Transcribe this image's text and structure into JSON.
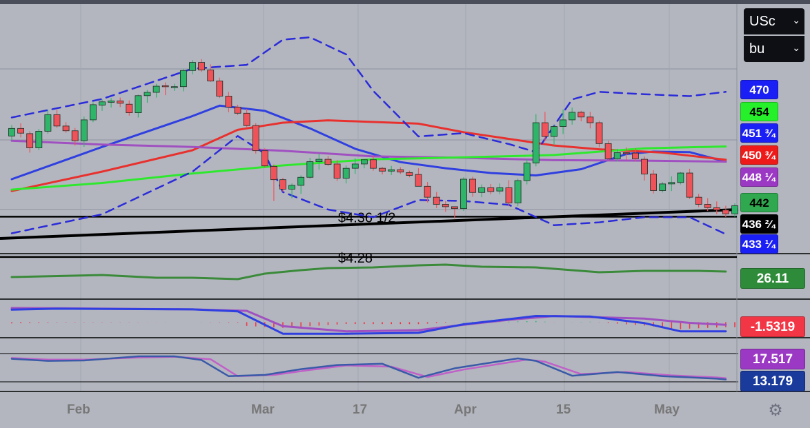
{
  "toolbar": {
    "currency": "USc",
    "unit": "bu",
    "chevron": "⌄"
  },
  "price_labels": [
    {
      "text": "470",
      "bg": "#1a1ff5"
    },
    {
      "text": "454",
      "bg": "#26f02a",
      "fg": "#000000"
    },
    {
      "text": "451 ³⁄₄",
      "bg": "#1a1ff5"
    },
    {
      "text": "450 ³⁄₄",
      "bg": "#ee1a1a"
    },
    {
      "text": "448 ¹⁄₄",
      "bg": "#9b38c4"
    },
    {
      "text": "442",
      "bg": "#2fa84f",
      "fg": "#000000"
    },
    {
      "text": "436 ²⁄₄",
      "bg": "#000000"
    },
    {
      "text": "433 ¹⁄₄",
      "bg": "#1a1ff5"
    }
  ],
  "oscillator_labels": [
    {
      "text": "26.11",
      "bg": "#2e8b3a"
    },
    {
      "text": "-1.5319",
      "bg": "#f23645"
    },
    {
      "text": "17.517",
      "bg": "#9b38c4"
    },
    {
      "text": "13.179",
      "bg": "#1a3a9c"
    }
  ],
  "annotations": [
    "$4.36 1/2",
    "$4.28"
  ],
  "x_axis": [
    "Feb",
    "Mar",
    "17",
    "Apr",
    "15",
    "May"
  ],
  "icons": {
    "settings": "gear-icon"
  },
  "colors": {
    "up": "#2fb56a",
    "down": "#f0525a",
    "boll": "#2b2bd9",
    "sma_green": "#2ee82e",
    "sma_purple": "#a050c0",
    "sma_red": "#e8312e",
    "sma_blue": "#2f3fe0"
  },
  "chart_data": {
    "type": "candlestick",
    "price_range": [
      429,
      481
    ],
    "levels": [
      {
        "name": "$4.36 1/2",
        "value": 436.5
      },
      {
        "name": "$4.28",
        "value": 428
      }
    ],
    "candles": [
      [
        453.5,
        455.8,
        452.6,
        455.1
      ],
      [
        455.1,
        456.2,
        453.2,
        454.1
      ],
      [
        454,
        454.5,
        450,
        451
      ],
      [
        451,
        455,
        450.5,
        454.5
      ],
      [
        454.5,
        459,
        454,
        458
      ],
      [
        458,
        459,
        455.2,
        455.6
      ],
      [
        455.6,
        456.4,
        454.2,
        454.6
      ],
      [
        454.6,
        455.2,
        451.5,
        452.5
      ],
      [
        452.5,
        457.6,
        451.2,
        456.9
      ],
      [
        456.9,
        460.6,
        456.4,
        460.1
      ],
      [
        460,
        461.2,
        458.8,
        460.7
      ],
      [
        460.6,
        461.5,
        459.5,
        460.9
      ],
      [
        460.9,
        461.6,
        459.6,
        460.4
      ],
      [
        460.2,
        461,
        457.8,
        458.4
      ],
      [
        458.4,
        462.2,
        457.4,
        462
      ],
      [
        462,
        463.2,
        460.5,
        462.7
      ],
      [
        462.7,
        464.5,
        461.6,
        464
      ],
      [
        464.1,
        464.8,
        462.1,
        463.9
      ],
      [
        463.9,
        464.5,
        463,
        463.9
      ],
      [
        463.9,
        467.7,
        462.9,
        467.3
      ],
      [
        467.3,
        469.5,
        466.5,
        469
      ],
      [
        469,
        469.7,
        467,
        467.4
      ],
      [
        467.4,
        468.6,
        464.9,
        465.1
      ],
      [
        465.1,
        465.8,
        461.5,
        461.9
      ],
      [
        461.9,
        462.8,
        458.5,
        459.6
      ],
      [
        459.6,
        460.1,
        457.9,
        458.3
      ],
      [
        458.3,
        459.2,
        455.4,
        455.7
      ],
      [
        455.7,
        456.2,
        449.8,
        450.4
      ],
      [
        450.4,
        450.9,
        446.9,
        447.2
      ],
      [
        447.1,
        447.5,
        439.8,
        444.3
      ],
      [
        444.3,
        444.7,
        441.8,
        442.3
      ],
      [
        442.3,
        443.5,
        440.4,
        443.1
      ],
      [
        443.1,
        445.2,
        441.3,
        444.8
      ],
      [
        444.8,
        448.9,
        444.5,
        448.1
      ],
      [
        448.1,
        449.7,
        446.4,
        448.6
      ],
      [
        448.6,
        449.3,
        447.2,
        447.5
      ],
      [
        447.6,
        448.4,
        444,
        444.6
      ],
      [
        444.6,
        447.3,
        443.5,
        446.7
      ],
      [
        446.7,
        448.8,
        445.5,
        447.6
      ],
      [
        447.6,
        448.6,
        446.7,
        448.5
      ],
      [
        448.5,
        449.3,
        446.2,
        446.7
      ],
      [
        446.7,
        447,
        445.4,
        446.1
      ],
      [
        446.1,
        447.2,
        445.3,
        446.4
      ],
      [
        446.4,
        446.9,
        445.5,
        445.9
      ],
      [
        445.8,
        446.2,
        444.8,
        445.2
      ],
      [
        445.4,
        446.7,
        442.9,
        442.9
      ],
      [
        442.9,
        443.8,
        439.5,
        440.6
      ],
      [
        440.6,
        441.7,
        438.3,
        439.1
      ],
      [
        439.1,
        439.8,
        437.5,
        438.6
      ],
      [
        438.6,
        438.5,
        436.1,
        438.2
      ],
      [
        438.2,
        444.8,
        437.7,
        444.4
      ],
      [
        444.4,
        444.9,
        440.7,
        441.6
      ],
      [
        441.6,
        443.3,
        440.6,
        442.6
      ],
      [
        442.6,
        443.4,
        441.2,
        441.8
      ],
      [
        441.9,
        443.5,
        441.2,
        442.6
      ],
      [
        442.6,
        444.2,
        438.7,
        439.4
      ],
      [
        439.4,
        444.5,
        438.7,
        444.1
      ],
      [
        444.1,
        448.6,
        443.3,
        447.8
      ],
      [
        447.8,
        458.1,
        447.1,
        456.3
      ],
      [
        456.3,
        458.6,
        452.4,
        453.4
      ],
      [
        453.4,
        455.8,
        451.6,
        455.5
      ],
      [
        455.5,
        459.1,
        453.9,
        456.9
      ],
      [
        456.9,
        459.5,
        455.9,
        458.5
      ],
      [
        458.5,
        458.8,
        456.6,
        457.5
      ],
      [
        457.5,
        458.6,
        455.1,
        456.3
      ],
      [
        456.3,
        456.7,
        451.1,
        451.9
      ],
      [
        451.9,
        452.5,
        448.4,
        448.7
      ],
      [
        448.7,
        450.8,
        448.1,
        450
      ],
      [
        450,
        451.1,
        448.4,
        449.9
      ],
      [
        449.9,
        450.9,
        448.2,
        448.7
      ],
      [
        448.6,
        449.2,
        444.1,
        445.5
      ],
      [
        445.5,
        446.3,
        441.4,
        442
      ],
      [
        442,
        443.8,
        441.6,
        443.4
      ],
      [
        443.4,
        445,
        441.9,
        443.7
      ],
      [
        443.7,
        445.9,
        443.3,
        445.7
      ],
      [
        445.7,
        446.6,
        440.2,
        440.6
      ],
      [
        440.6,
        441.3,
        438.5,
        439.1
      ],
      [
        439.1,
        440.4,
        437.7,
        438.4
      ],
      [
        438.4,
        439.7,
        437,
        437.9
      ],
      [
        437.9,
        438.8,
        436.4,
        437.1
      ],
      [
        437.1,
        439.3,
        436.5,
        438.8
      ]
    ],
    "series": [
      {
        "name": "sma20",
        "color": "#2f3fe0",
        "values": [
          [
            0,
            444.4
          ],
          [
            10,
            451.2
          ],
          [
            20,
            457.7
          ],
          [
            23,
            459.9
          ],
          [
            28,
            458.8
          ],
          [
            33,
            455.1
          ],
          [
            38,
            450.8
          ],
          [
            43,
            448
          ],
          [
            48,
            446.7
          ],
          [
            53,
            445.7
          ],
          [
            58,
            445.2
          ],
          [
            63,
            446.5
          ],
          [
            68,
            449.7
          ],
          [
            71,
            450.2
          ],
          [
            75,
            450.1
          ],
          [
            79,
            448.1
          ]
        ]
      },
      {
        "name": "sma50",
        "color": "#e8312e",
        "values": [
          [
            0,
            441.9
          ],
          [
            10,
            446
          ],
          [
            20,
            450.5
          ],
          [
            25,
            454.8
          ],
          [
            30,
            456.3
          ],
          [
            35,
            456.8
          ],
          [
            45,
            456.1
          ],
          [
            50,
            454.3
          ],
          [
            55,
            452.9
          ],
          [
            60,
            451.5
          ],
          [
            65,
            450.7
          ],
          [
            72,
            450
          ],
          [
            79,
            448.5
          ]
        ]
      },
      {
        "name": "sma100",
        "color": "#a050c0",
        "values": [
          [
            0,
            452.5
          ],
          [
            10,
            451.7
          ],
          [
            20,
            451.2
          ],
          [
            30,
            450.4
          ],
          [
            40,
            449.2
          ],
          [
            50,
            448.9
          ],
          [
            60,
            448.4
          ],
          [
            70,
            448.3
          ],
          [
            79,
            448.1
          ]
        ]
      },
      {
        "name": "sma200",
        "color": "#2ee82e",
        "values": [
          [
            0,
            442.2
          ],
          [
            10,
            443.6
          ],
          [
            20,
            445.6
          ],
          [
            30,
            447.3
          ],
          [
            40,
            448.6
          ],
          [
            50,
            449
          ],
          [
            60,
            449.5
          ],
          [
            70,
            450.9
          ],
          [
            79,
            451.3
          ]
        ]
      },
      {
        "name": "boll_upper",
        "color": "#2b2bd9",
        "dashed": true,
        "values": [
          [
            0,
            457.4
          ],
          [
            10,
            461.3
          ],
          [
            20,
            467.7
          ],
          [
            26,
            468.5
          ],
          [
            30,
            473.8
          ],
          [
            33,
            474.3
          ],
          [
            37,
            470.7
          ],
          [
            40,
            463
          ],
          [
            45,
            453.4
          ],
          [
            50,
            454.1
          ],
          [
            55,
            451.8
          ],
          [
            58,
            450.1
          ],
          [
            62,
            461.2
          ],
          [
            65,
            462.8
          ],
          [
            70,
            462.3
          ],
          [
            75,
            461.9
          ],
          [
            79,
            462.8
          ]
        ]
      },
      {
        "name": "boll_lower",
        "color": "#2b2bd9",
        "dashed": true,
        "values": [
          [
            0,
            433
          ],
          [
            10,
            437
          ],
          [
            20,
            446
          ],
          [
            25,
            453.5
          ],
          [
            28,
            449.8
          ],
          [
            30,
            441.7
          ],
          [
            35,
            438
          ],
          [
            40,
            436.4
          ],
          [
            45,
            440
          ],
          [
            50,
            439.8
          ],
          [
            55,
            439
          ],
          [
            60,
            434.7
          ],
          [
            65,
            435.3
          ],
          [
            70,
            436.4
          ],
          [
            75,
            436.4
          ],
          [
            79,
            432.8
          ]
        ]
      }
    ],
    "adx": {
      "name": "ADX",
      "color": "#3a8a3a",
      "last": 26.11,
      "values": [
        [
          0,
          30
        ],
        [
          10,
          33
        ],
        [
          16,
          29
        ],
        [
          20,
          29
        ],
        [
          25,
          27
        ],
        [
          28,
          35
        ],
        [
          32,
          40
        ],
        [
          35,
          43
        ],
        [
          40,
          44
        ],
        [
          45,
          47
        ],
        [
          48,
          48
        ],
        [
          52,
          45
        ],
        [
          58,
          44
        ],
        [
          65,
          37
        ],
        [
          70,
          39
        ],
        [
          76,
          39
        ],
        [
          79,
          38
        ]
      ]
    },
    "macd": {
      "last": -1.5319,
      "macd": [
        [
          0,
          11.3
        ],
        [
          5,
          11.7
        ],
        [
          20,
          11.4
        ],
        [
          25,
          10.6
        ],
        [
          30,
          1.1
        ],
        [
          37,
          1.1
        ],
        [
          45,
          1.5
        ],
        [
          50,
          5.1
        ],
        [
          58,
          8.6
        ],
        [
          64,
          8.4
        ],
        [
          70,
          5.6
        ],
        [
          74,
          2.1
        ],
        [
          79,
          2.1
        ]
      ],
      "signal": [
        [
          0,
          12
        ],
        [
          5,
          11.9
        ],
        [
          20,
          11.4
        ],
        [
          26,
          10.8
        ],
        [
          30,
          4.3
        ],
        [
          37,
          2.1
        ],
        [
          45,
          2.6
        ],
        [
          50,
          4.9
        ],
        [
          55,
          7
        ],
        [
          60,
          8.6
        ],
        [
          70,
          7.5
        ],
        [
          75,
          5.7
        ],
        [
          79,
          4.9
        ]
      ]
    },
    "stoch": {
      "k_last": 13.179,
      "d_last": 17.517,
      "k": [
        [
          0,
          69
        ],
        [
          4,
          64
        ],
        [
          8,
          65
        ],
        [
          14,
          75
        ],
        [
          18,
          75
        ],
        [
          21,
          66
        ],
        [
          24,
          27
        ],
        [
          28,
          30
        ],
        [
          32,
          44
        ],
        [
          36,
          54
        ],
        [
          41,
          57
        ],
        [
          45,
          23
        ],
        [
          49,
          46
        ],
        [
          56,
          70
        ],
        [
          58,
          64
        ],
        [
          62,
          28
        ],
        [
          67,
          37
        ],
        [
          72,
          27
        ],
        [
          78,
          21
        ],
        [
          79,
          19
        ]
      ],
      "d": [
        [
          0,
          71
        ],
        [
          4,
          67
        ],
        [
          8,
          67
        ],
        [
          14,
          72
        ],
        [
          18,
          74
        ],
        [
          22,
          68
        ],
        [
          25,
          27
        ],
        [
          29,
          30
        ],
        [
          33,
          42
        ],
        [
          37,
          53
        ],
        [
          42,
          50
        ],
        [
          46,
          25
        ],
        [
          50,
          43
        ],
        [
          57,
          67
        ],
        [
          59,
          62
        ],
        [
          63,
          32
        ],
        [
          68,
          37
        ],
        [
          73,
          29
        ],
        [
          78,
          24
        ],
        [
          79,
          22
        ]
      ]
    }
  }
}
